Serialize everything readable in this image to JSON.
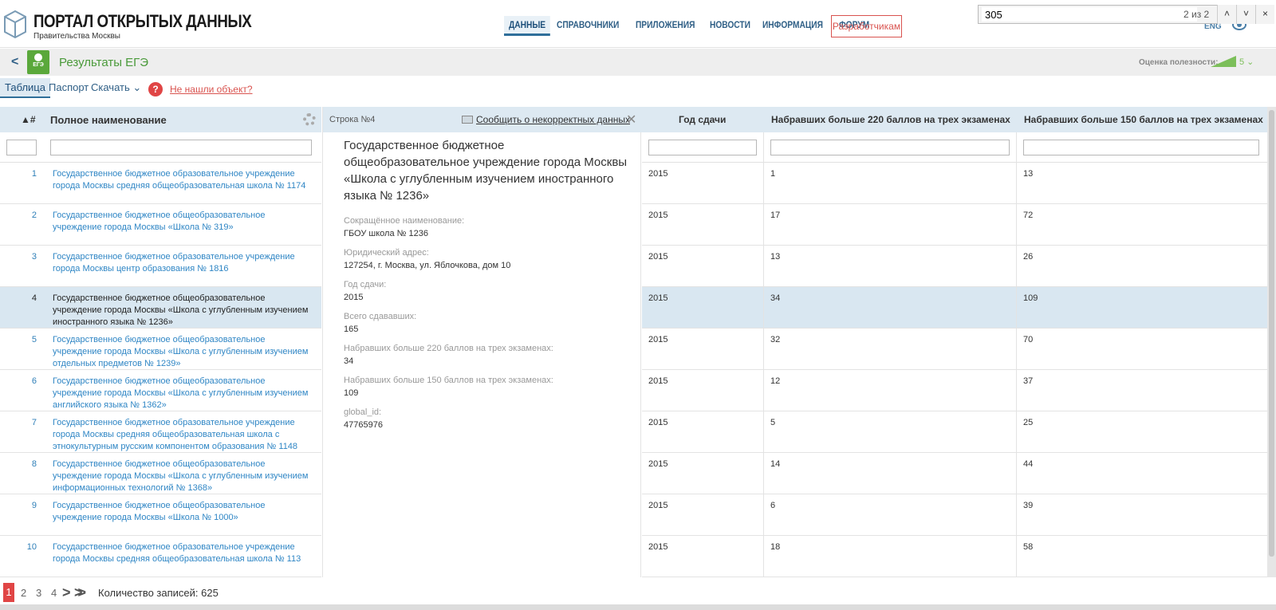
{
  "header": {
    "logo_title": "ПОРТАЛ ОТКРЫТЫХ ДАННЫХ",
    "logo_subtitle": "Правительства Москвы",
    "nav": [
      "ДАННЫЕ",
      "СПРАВОЧНИКИ",
      "ПРИЛОЖЕНИЯ",
      "НОВОСТИ",
      "ИНФОРМАЦИЯ",
      "ФОРУМ"
    ],
    "developers_button": "Разработчикам",
    "lang": "ENG",
    "icons": {
      "logo": "portal-box-icon",
      "view": "eye-icon"
    }
  },
  "findbar": {
    "query": "305",
    "count": "2 из 2",
    "up": "˄",
    "down": "˅",
    "close": "×"
  },
  "titlebar": {
    "title": "Результаты ЕГЭ",
    "badge": "ЕГЭ",
    "usefulness_label": "Оценка полезности:",
    "usefulness_value": "5 ⌄",
    "back": "<"
  },
  "tabs": {
    "table": "Таблица",
    "passport": "Паспорт",
    "download": "Скачать ⌄",
    "not_found": "Не нашли объект?"
  },
  "left_table": {
    "col_num": "▲#",
    "col_name": "Полное наименование",
    "rows": [
      {
        "num": "1",
        "name": "Государственное бюджетное образовательное учреждение города Москвы средняя общеобразовательная школа № 1174"
      },
      {
        "num": "2",
        "name": "Государственное бюджетное общеобразовательное учреждение города Москвы «Школа № 319»"
      },
      {
        "num": "3",
        "name": "Государственное бюджетное образовательное учреждение города Москвы центр образования № 1816"
      },
      {
        "num": "4",
        "name": "Государственное бюджетное общеобразовательное учреждение города Москвы «Школа с углубленным изучением иностранного языка № 1236»"
      },
      {
        "num": "5",
        "name": "Государственное бюджетное общеобразовательное учреждение города Москвы «Школа с углубленным изучением отдельных предметов № 1239»"
      },
      {
        "num": "6",
        "name": "Государственное бюджетное общеобразовательное учреждение города Москвы «Школа с углубленным изучением английского языка № 1362»"
      },
      {
        "num": "7",
        "name": "Государственное бюджетное образовательное учреждение города Москвы средняя общеобразовательная школа с этнокультурным русским компонентом образования № 1148"
      },
      {
        "num": "8",
        "name": "Государственное бюджетное общеобразовательное учреждение города Москвы «Школа с углубленным изучением информационных технологий № 1368»"
      },
      {
        "num": "9",
        "name": "Государственное бюджетное общеобразовательное учреждение города Москвы «Школа № 1000»"
      },
      {
        "num": "10",
        "name": "Государственное бюджетное образовательное учреждение города Москвы средняя общеобразовательная школа № 113"
      }
    ]
  },
  "detail": {
    "row_label": "Строка №4",
    "report": "Сообщить о некорректных данных",
    "close": "✕",
    "title": "Государственное бюджетное общеобразовательное учреждение города Москвы «Школа с углубленным изучением иностранного языка № 1236»",
    "fields": [
      {
        "label": "Сокращённое наименование:",
        "value": "ГБОУ школа № 1236"
      },
      {
        "label": "Юридический адрес:",
        "value": "127254, г. Москва, ул. Яблочкова, дом 10"
      },
      {
        "label": "Год сдачи:",
        "value": "2015"
      },
      {
        "label": "Всего сдававших:",
        "value": "165"
      },
      {
        "label": "Набравших больше 220 баллов на трех экзаменах:",
        "value": "34"
      },
      {
        "label": "Набравших больше 150 баллов на трех экзаменах:",
        "value": "109"
      },
      {
        "label": "global_id:",
        "value": "47765976"
      }
    ]
  },
  "right_table": {
    "headers": [
      "Год сдачи",
      "Набравших больше 220 баллов на трех экзаменах",
      "Набравших больше 150 баллов на трех экзаменах"
    ],
    "rows": [
      [
        "2015",
        "1",
        "13"
      ],
      [
        "2015",
        "17",
        "72"
      ],
      [
        "2015",
        "13",
        "26"
      ],
      [
        "2015",
        "34",
        "109"
      ],
      [
        "2015",
        "32",
        "70"
      ],
      [
        "2015",
        "12",
        "37"
      ],
      [
        "2015",
        "5",
        "25"
      ],
      [
        "2015",
        "14",
        "44"
      ],
      [
        "2015",
        "6",
        "39"
      ],
      [
        "2015",
        "18",
        "58"
      ]
    ]
  },
  "pager": {
    "pages": [
      "1",
      "2",
      "3",
      "4"
    ],
    "next": ">",
    "last": ">>",
    "total": "Количество записей: 625"
  }
}
